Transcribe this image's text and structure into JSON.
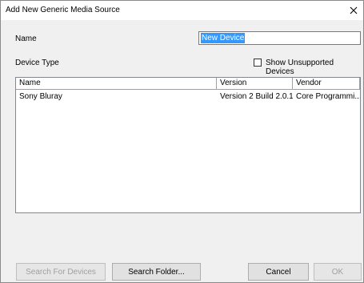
{
  "window": {
    "title": "Add New Generic Media Source"
  },
  "form": {
    "name_label": "Name",
    "name_value": "New Device",
    "device_type_label": "Device Type",
    "show_unsupported_label": "Show Unsupported Devices",
    "show_unsupported_checked": false
  },
  "list": {
    "columns": [
      "Name",
      "Version",
      "Vendor"
    ],
    "rows": [
      {
        "name": "Sony Bluray",
        "version": "Version 2 Build 2.0.1",
        "vendor": "Core Programmi..."
      }
    ]
  },
  "buttons": {
    "search_devices": "Search For Devices",
    "search_folder": "Search Folder...",
    "cancel": "Cancel",
    "ok": "OK"
  },
  "icons": {
    "close": "close-icon",
    "checkbox": "checkbox-icon"
  }
}
